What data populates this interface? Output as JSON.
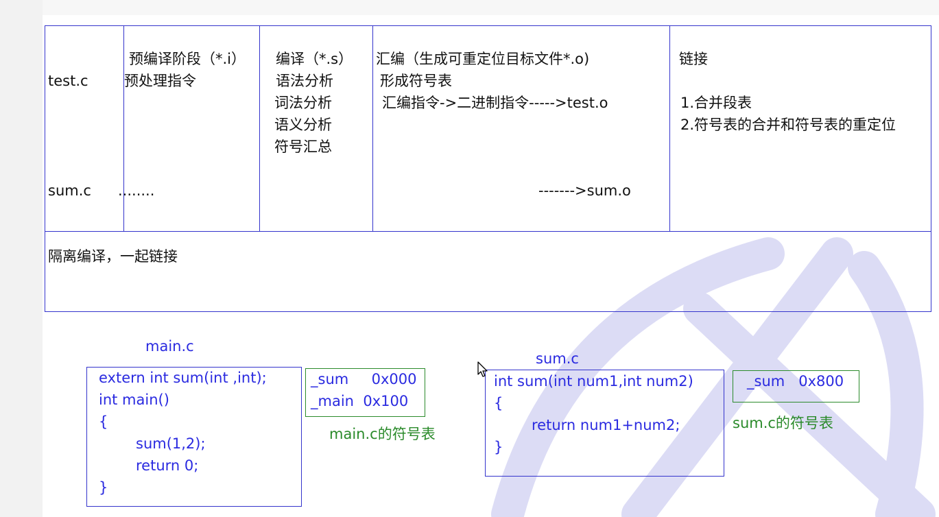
{
  "table": {
    "col_file": [
      "test.c",
      "sum.c"
    ],
    "col_precompile": {
      "title": "预编译阶段（*.i）",
      "line": "预处理指令",
      "sum_row": "........"
    },
    "col_compile": {
      "title": "编译（*.s）",
      "lines": [
        "语法分析",
        "词法分析",
        "语义分析",
        "符号汇总"
      ]
    },
    "col_assemble": {
      "title": "汇编（生成可重定位目标文件*.o)",
      "line1": "形成符号表",
      "line2": "汇编指令->二进制指令----->test.o",
      "sum_row": "------->sum.o"
    },
    "col_link": {
      "title": "链接",
      "items": [
        "1.合并段表",
        "2.符号表的合并和符号表的重定位"
      ]
    },
    "note": "隔离编译，一起链接"
  },
  "main_c": {
    "label": "main.c",
    "code": [
      "extern int sum(int ,int);",
      "int main()",
      "{",
      "sum(1,2);",
      "return 0;",
      "}"
    ],
    "symbols": [
      "_sum     0x000",
      "_main  0x100"
    ],
    "symbols_caption": "main.c的符号表"
  },
  "sum_c": {
    "label": "sum.c",
    "code": [
      "int sum(int num1,int num2)",
      "{",
      "return num1+num2;",
      "}"
    ],
    "symbols": [
      "_sum   0x800"
    ],
    "symbols_caption": "sum.c的符号表"
  },
  "colors": {
    "border": "#3333cc",
    "code": "#2a2ae0",
    "symbol": "#2a8a2a",
    "watermark": "#dcdcf5"
  },
  "icons": {
    "cursor": "mouse-pointer-icon",
    "watermark": "watermark-logo"
  }
}
